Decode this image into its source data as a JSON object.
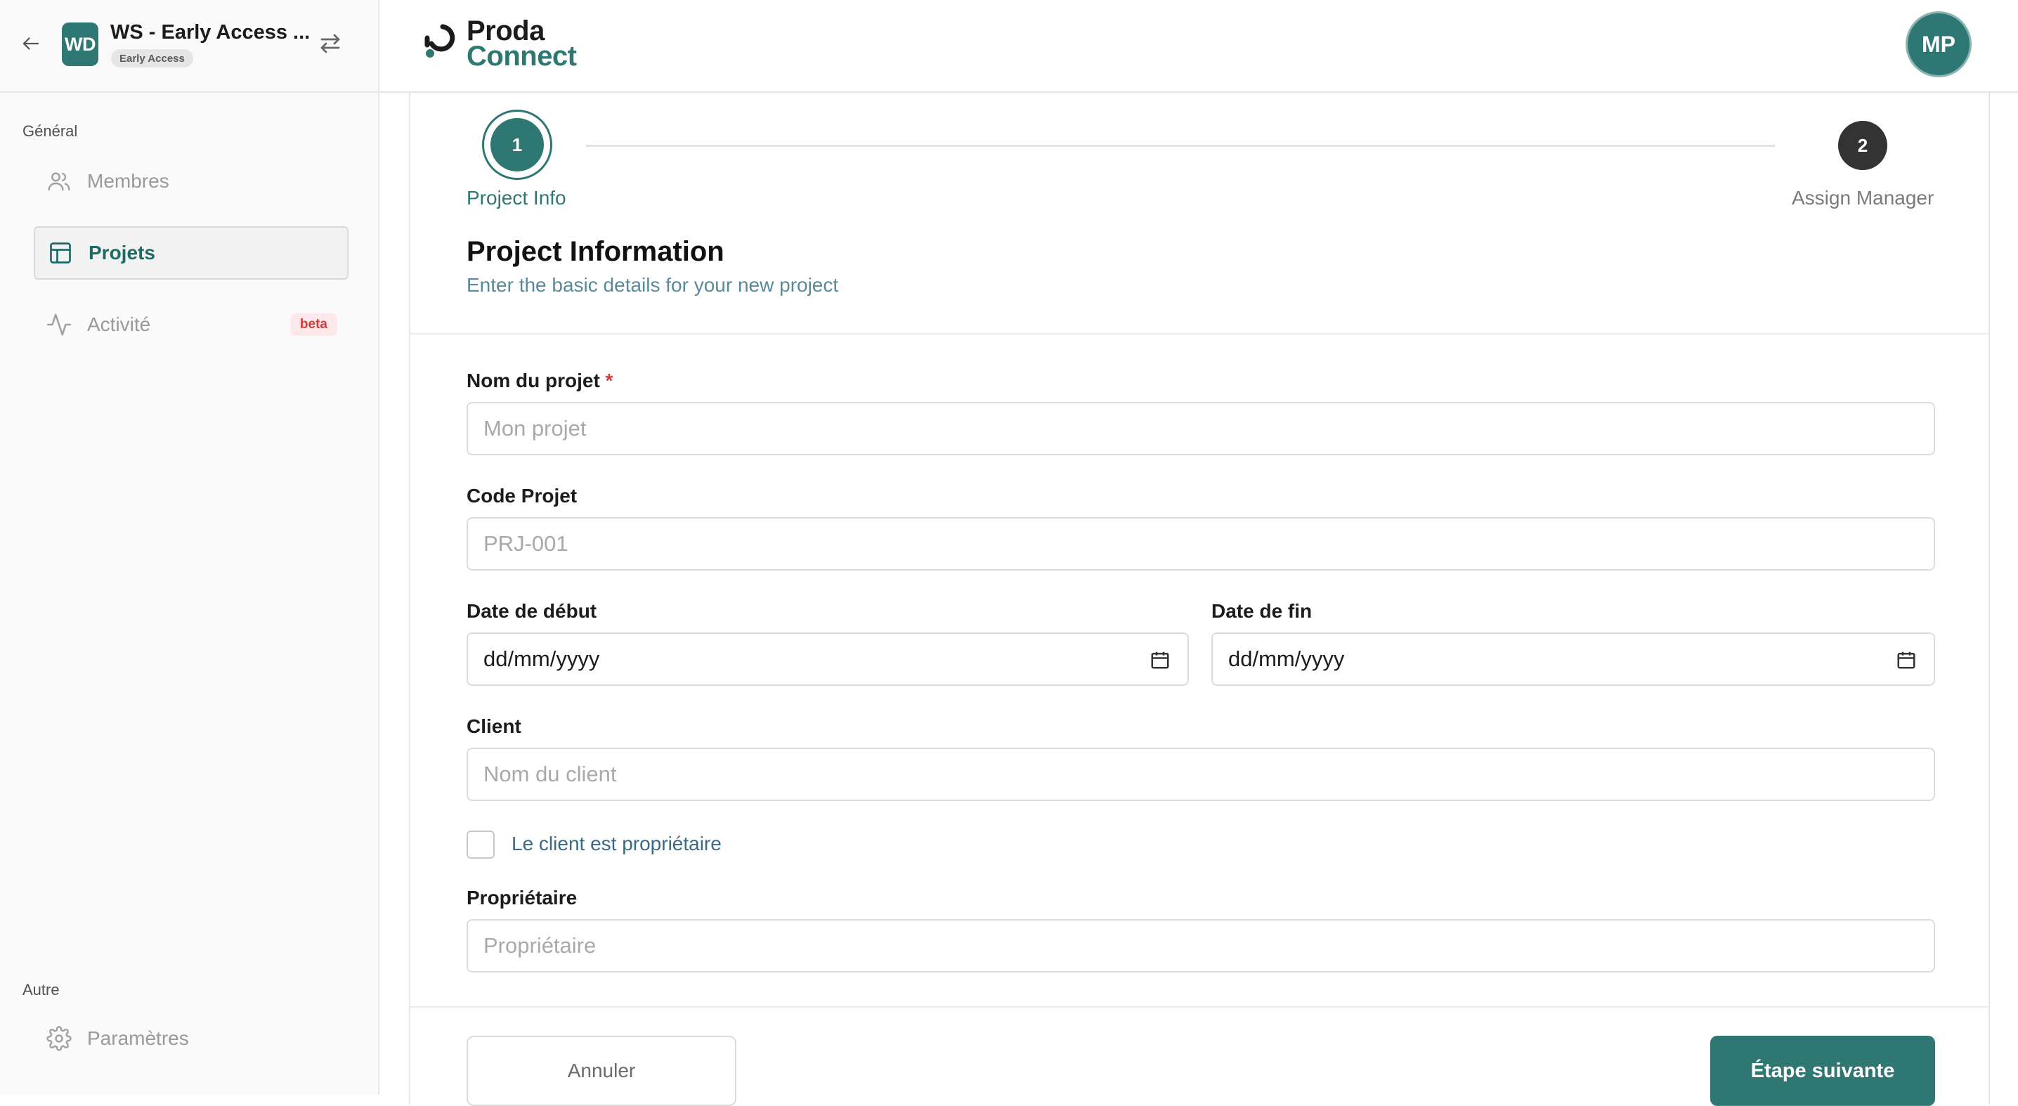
{
  "colors": {
    "accent": "#2e7772",
    "required": "#d33b3b",
    "beta_bg": "#fde9e9",
    "subtitle": "#5a8a99"
  },
  "workspace": {
    "avatar_initials": "WD",
    "name": "WS - Early Access ...",
    "badge": "Early Access"
  },
  "sidebar": {
    "sections": [
      {
        "label": "Général",
        "items": [
          {
            "label": "Membres",
            "icon": "users-icon",
            "active": false
          },
          {
            "label": "Projets",
            "icon": "layout-icon",
            "active": true
          },
          {
            "label": "Activité",
            "icon": "activity-icon",
            "active": false,
            "badge": "beta"
          }
        ]
      },
      {
        "label": "Autre",
        "items": [
          {
            "label": "Paramètres",
            "icon": "gear-icon",
            "active": false
          }
        ]
      }
    ]
  },
  "header": {
    "logo_line1": "Proda",
    "logo_line2": "Connect",
    "user_initials": "MP"
  },
  "stepper": {
    "steps": [
      {
        "number": "1",
        "label": "Project Info",
        "active": true
      },
      {
        "number": "2",
        "label": "Assign Manager",
        "active": false
      }
    ]
  },
  "form": {
    "title": "Project Information",
    "subtitle": "Enter the basic details for your new project",
    "project_name": {
      "label": "Nom du projet",
      "required_mark": "*",
      "placeholder": "Mon projet",
      "value": ""
    },
    "project_code": {
      "label": "Code Projet",
      "placeholder": "PRJ-001",
      "value": ""
    },
    "start_date": {
      "label": "Date de début",
      "placeholder": "dd/mm/yyyy"
    },
    "end_date": {
      "label": "Date de fin",
      "placeholder": "dd/mm/yyyy"
    },
    "client": {
      "label": "Client",
      "placeholder": "Nom du client",
      "value": ""
    },
    "client_is_owner": {
      "label": "Le client est propriétaire",
      "checked": false
    },
    "owner": {
      "label": "Propriétaire",
      "placeholder": "Propriétaire",
      "value": ""
    },
    "cancel_label": "Annuler",
    "next_label": "Étape suivante"
  }
}
